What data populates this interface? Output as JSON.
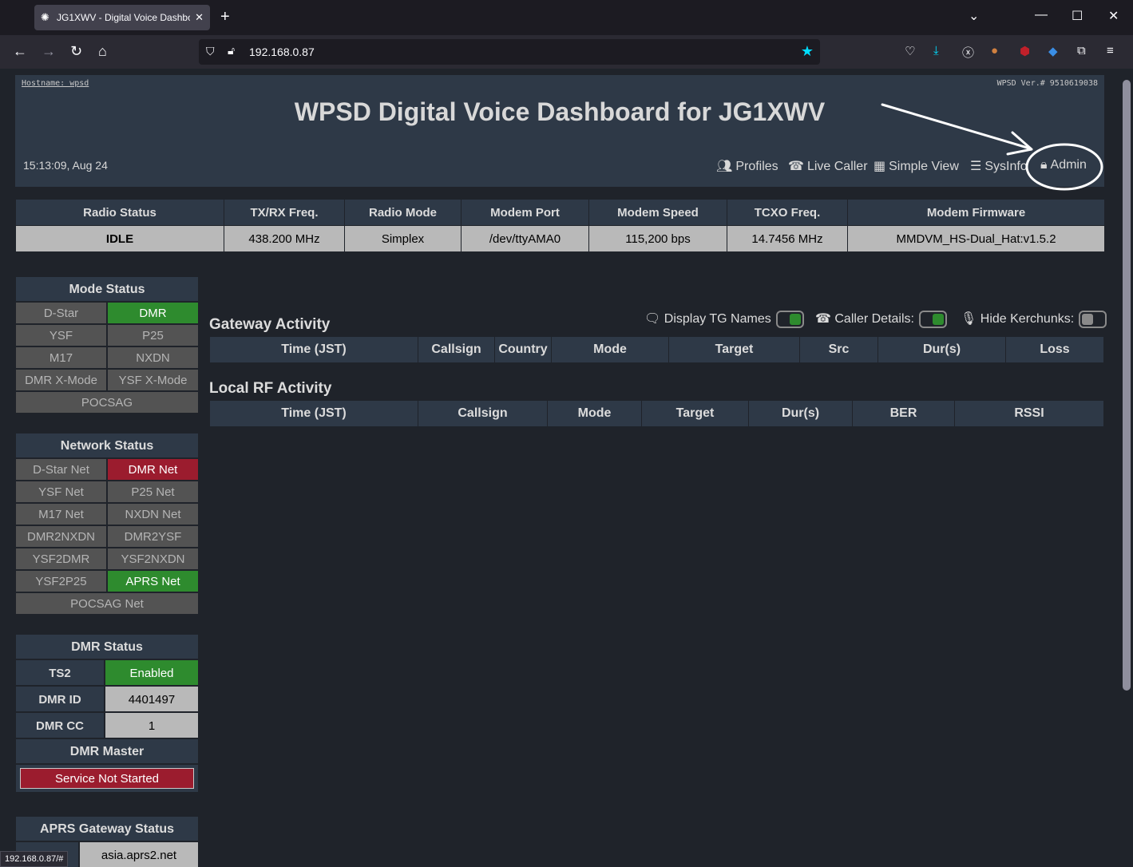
{
  "browser": {
    "tab_title": "JG1XWV - Digital Voice Dashbo",
    "tab_close": "✕",
    "new_tab": "+",
    "url": "192.168.0.87",
    "status_url": "192.168.0.87/#",
    "window_controls": {
      "minimize": "—",
      "maximize": "☐",
      "close": "✕",
      "list": "⌄"
    },
    "nav": {
      "back": "←",
      "forward": "→",
      "reload": "↻",
      "home": "⌂"
    }
  },
  "header": {
    "hostname": "Hostname: wpsd",
    "version": "WPSD Ver.# 9510619038",
    "title": "WPSD Digital Voice Dashboard for JG1XWV",
    "clock": "15:13:09, Aug 24",
    "nav": {
      "profiles": "Profiles",
      "live_caller": "Live Caller",
      "simple_view": "Simple View",
      "sysinfo": "SysInfo",
      "admin": "Admin"
    }
  },
  "radio_table": {
    "headers": [
      "Radio Status",
      "TX/RX Freq.",
      "Radio Mode",
      "Modem Port",
      "Modem Speed",
      "TCXO Freq.",
      "Modem Firmware"
    ],
    "values": [
      "IDLE",
      "438.200 MHz",
      "Simplex",
      "/dev/ttyAMA0",
      "115,200 bps",
      "14.7456 MHz",
      "MMDVM_HS-Dual_Hat:v1.5.2"
    ]
  },
  "mode_status": {
    "title": "Mode Status",
    "items": [
      {
        "label": "D-Star",
        "state": "inactive"
      },
      {
        "label": "DMR",
        "state": "on"
      },
      {
        "label": "YSF",
        "state": "inactive"
      },
      {
        "label": "P25",
        "state": "inactive"
      },
      {
        "label": "M17",
        "state": "inactive"
      },
      {
        "label": "NXDN",
        "state": "inactive"
      },
      {
        "label": "DMR X-Mode",
        "state": "inactive"
      },
      {
        "label": "YSF X-Mode",
        "state": "inactive"
      },
      {
        "label": "POCSAG",
        "state": "inactive"
      }
    ]
  },
  "network_status": {
    "title": "Network Status",
    "items": [
      {
        "label": "D-Star Net",
        "state": "inactive"
      },
      {
        "label": "DMR Net",
        "state": "off"
      },
      {
        "label": "YSF Net",
        "state": "inactive"
      },
      {
        "label": "P25 Net",
        "state": "inactive"
      },
      {
        "label": "M17 Net",
        "state": "inactive"
      },
      {
        "label": "NXDN Net",
        "state": "inactive"
      },
      {
        "label": "DMR2NXDN",
        "state": "inactive"
      },
      {
        "label": "DMR2YSF",
        "state": "inactive"
      },
      {
        "label": "YSF2DMR",
        "state": "inactive"
      },
      {
        "label": "YSF2NXDN",
        "state": "inactive"
      },
      {
        "label": "YSF2P25",
        "state": "inactive"
      },
      {
        "label": "APRS Net",
        "state": "on"
      },
      {
        "label": "POCSAG Net",
        "state": "inactive"
      }
    ]
  },
  "dmr_status": {
    "title": "DMR Status",
    "ts2_label": "TS2",
    "ts2_value": "Enabled",
    "dmr_id_label": "DMR ID",
    "dmr_id_value": "4401497",
    "dmr_cc_label": "DMR CC",
    "dmr_cc_value": "1",
    "master_title": "DMR Master",
    "master_value": "Service Not Started"
  },
  "aprs_status": {
    "title": "APRS Gateway Status",
    "server": "asia.aprs2.net"
  },
  "gateway_activity": {
    "title": "Gateway Activity",
    "toggle_tg_names": {
      "label": "Display TG Names",
      "on": true
    },
    "toggle_caller_details": {
      "label": "Caller Details:",
      "on": true
    },
    "toggle_hide_kerchunks": {
      "label": "Hide Kerchunks:",
      "on": false
    },
    "headers": [
      "Time (JST)",
      "Callsign",
      "Country",
      "Mode",
      "Target",
      "Src",
      "Dur(s)",
      "Loss"
    ]
  },
  "local_rf": {
    "title": "Local RF Activity",
    "headers": [
      "Time (JST)",
      "Callsign",
      "Mode",
      "Target",
      "Dur(s)",
      "BER",
      "RSSI"
    ]
  }
}
